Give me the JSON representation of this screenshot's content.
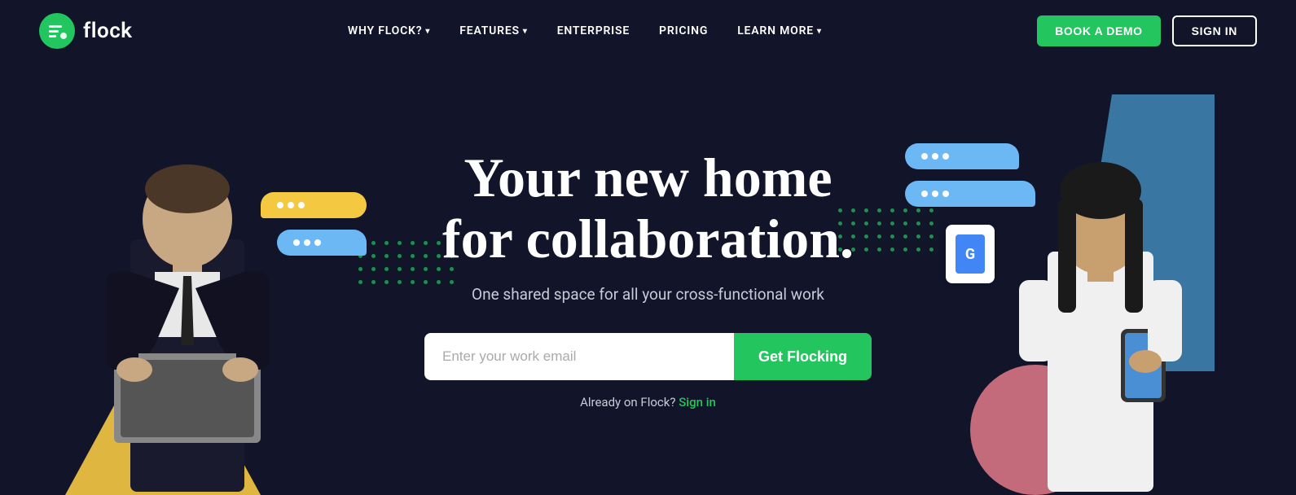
{
  "nav": {
    "logo_text": "flock",
    "links": [
      {
        "label": "WHY FLOCK?",
        "has_dropdown": true
      },
      {
        "label": "FEATURES",
        "has_dropdown": true
      },
      {
        "label": "ENTERPRISE",
        "has_dropdown": false
      },
      {
        "label": "PRICING",
        "has_dropdown": false
      },
      {
        "label": "LEARN MORE",
        "has_dropdown": true
      }
    ],
    "book_demo_label": "BOOK A DEMO",
    "sign_in_label": "SIGN IN"
  },
  "hero": {
    "title_line1": "Your new home",
    "title_line2": "for collaboration.",
    "subtitle": "One shared space for all your cross-functional work",
    "email_placeholder": "Enter your work email",
    "cta_label": "Get Flocking",
    "already_text": "Already on Flock?",
    "sign_in_link_label": "Sign in"
  },
  "colors": {
    "bg": "#12152a",
    "accent_green": "#22c55e",
    "accent_yellow": "#f5c842",
    "accent_blue": "#6bb8f5",
    "accent_pink": "#f08090"
  }
}
